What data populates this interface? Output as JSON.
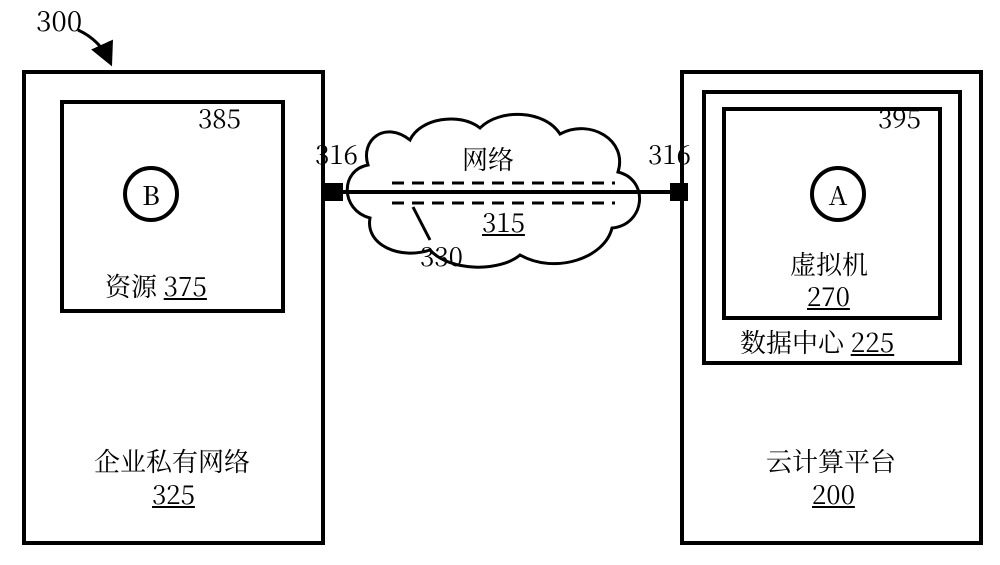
{
  "refs": {
    "fig": "300",
    "ep_b": "385",
    "ep_a": "395",
    "gw_left": "316",
    "gw_right": "316",
    "tunnel": "330",
    "network": "315",
    "resource": "375",
    "vm": "270",
    "datacenter": "225",
    "private_net": "325",
    "cloud": "200"
  },
  "nodes": {
    "b_letter": "B",
    "a_letter": "A"
  },
  "labels": {
    "network": "网络",
    "resource": "资源",
    "vm": "虚拟机",
    "datacenter": "数据中心",
    "private_net": "企业私有网络",
    "cloud": "云计算平台"
  }
}
